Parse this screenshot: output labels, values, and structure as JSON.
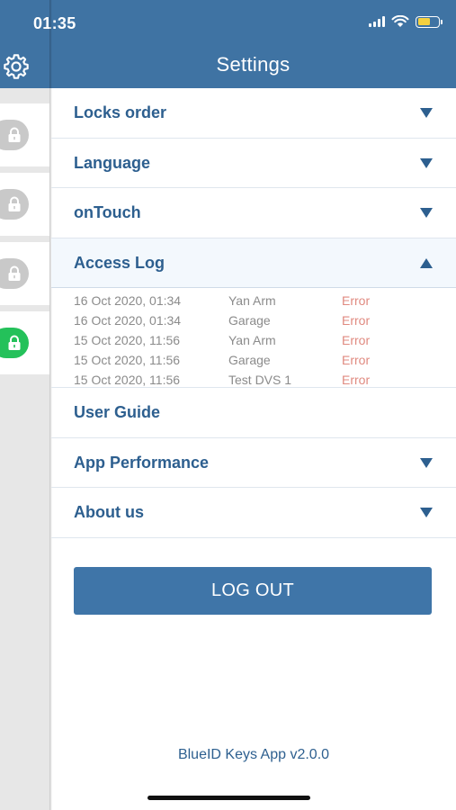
{
  "status_bar": {
    "time": "01:35"
  },
  "header": {
    "title": "Settings"
  },
  "left_strip": {
    "locks": [
      {
        "state": "locked",
        "color": "#c9c9c9"
      },
      {
        "state": "locked",
        "color": "#c9c9c9"
      },
      {
        "state": "locked",
        "color": "#c9c9c9"
      },
      {
        "state": "unlocked",
        "color": "#24c15a"
      }
    ]
  },
  "settings": {
    "locks_order": "Locks order",
    "language": "Language",
    "on_touch": "onTouch",
    "access_log": "Access Log",
    "user_guide": "User Guide",
    "app_performance": "App Performance",
    "about_us": "About us"
  },
  "access_log": {
    "entries": [
      {
        "date": "16 Oct 2020, 01:34",
        "lock": "Yan Arm",
        "status": "Error"
      },
      {
        "date": "16 Oct 2020, 01:34",
        "lock": "Garage",
        "status": "Error"
      },
      {
        "date": "15 Oct 2020, 11:56",
        "lock": "Yan Arm",
        "status": "Error"
      },
      {
        "date": "15 Oct 2020, 11:56",
        "lock": "Garage",
        "status": "Error"
      },
      {
        "date": "15 Oct 2020, 11:56",
        "lock": "Test DVS 1",
        "status": "Error"
      }
    ]
  },
  "logout_label": "LOG OUT",
  "version": "BlueID Keys App v2.0.0",
  "colors": {
    "header": "#3f73a3",
    "accent_text": "#2d5f8f",
    "error": "#e08a80",
    "unlocked": "#24c15a"
  }
}
